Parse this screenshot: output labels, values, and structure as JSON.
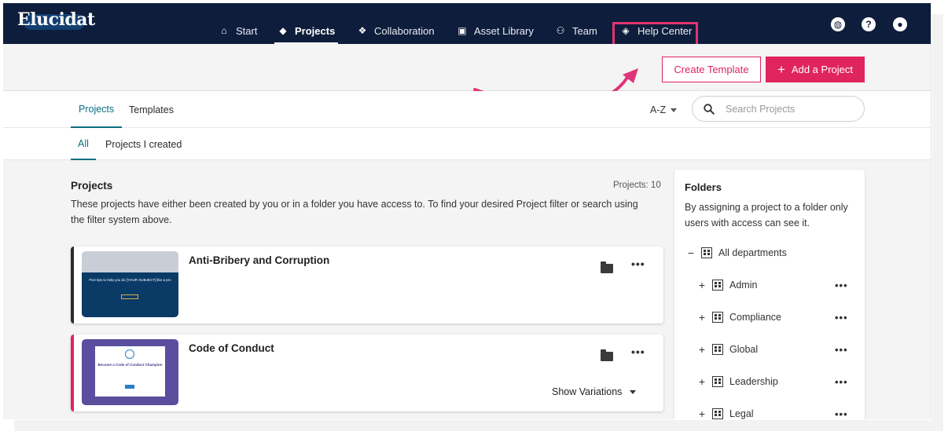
{
  "app": {
    "logo": "Elucidat"
  },
  "nav": {
    "items": [
      {
        "label": "Start",
        "icon": "home-icon"
      },
      {
        "label": "Projects",
        "icon": "layers-icon",
        "active": true
      },
      {
        "label": "Collaboration",
        "icon": "handshake-icon"
      },
      {
        "label": "Asset Library",
        "icon": "image-gallery-icon"
      },
      {
        "label": "Team",
        "icon": "users-icon"
      },
      {
        "label": "Help Center",
        "icon": "graduation-cap-icon",
        "highlighted": true
      }
    ],
    "right_icons": [
      "globe-icon",
      "help-icon",
      "user-icon"
    ]
  },
  "actions": {
    "create_template": "Create Template",
    "add_project": "Add a Project"
  },
  "tabs": {
    "items": [
      "Projects",
      "Templates"
    ],
    "active": "Projects"
  },
  "sort": {
    "value": "A-Z"
  },
  "search": {
    "placeholder": "Search Projects"
  },
  "subtabs": {
    "items": [
      "All",
      "Projects I created"
    ],
    "active": "All"
  },
  "main": {
    "title": "Projects",
    "count": "Projects: 10",
    "description": "These projects have either been created by you or in a folder you have access to. To find your desired Project filter or search using the filter system above."
  },
  "projects": [
    {
      "title": "Anti-Bribery and Corruption",
      "thumb_text": "Five tips to help you do [YOUR SUBJECT] like a pro",
      "accent": "#2b2b2b"
    },
    {
      "title": "Code of Conduct",
      "thumb_text": "Become a Code of Conduct Champion",
      "show_variations": "Show Variations",
      "accent": "#e0245e"
    }
  ],
  "folders": {
    "title": "Folders",
    "description": "By assigning a project to a folder only users with access can see it.",
    "root": {
      "label": "All departments",
      "sign": "−"
    },
    "items": [
      {
        "label": "Admin",
        "sign": "+"
      },
      {
        "label": "Compliance",
        "sign": "+"
      },
      {
        "label": "Global",
        "sign": "+"
      },
      {
        "label": "Leadership",
        "sign": "+"
      },
      {
        "label": "Legal",
        "sign": "+"
      }
    ]
  },
  "colors": {
    "nav_bg": "#0e1d3b",
    "accent": "#e0245e",
    "tab_active": "#0b6e82",
    "highlight": "#e2336f"
  }
}
